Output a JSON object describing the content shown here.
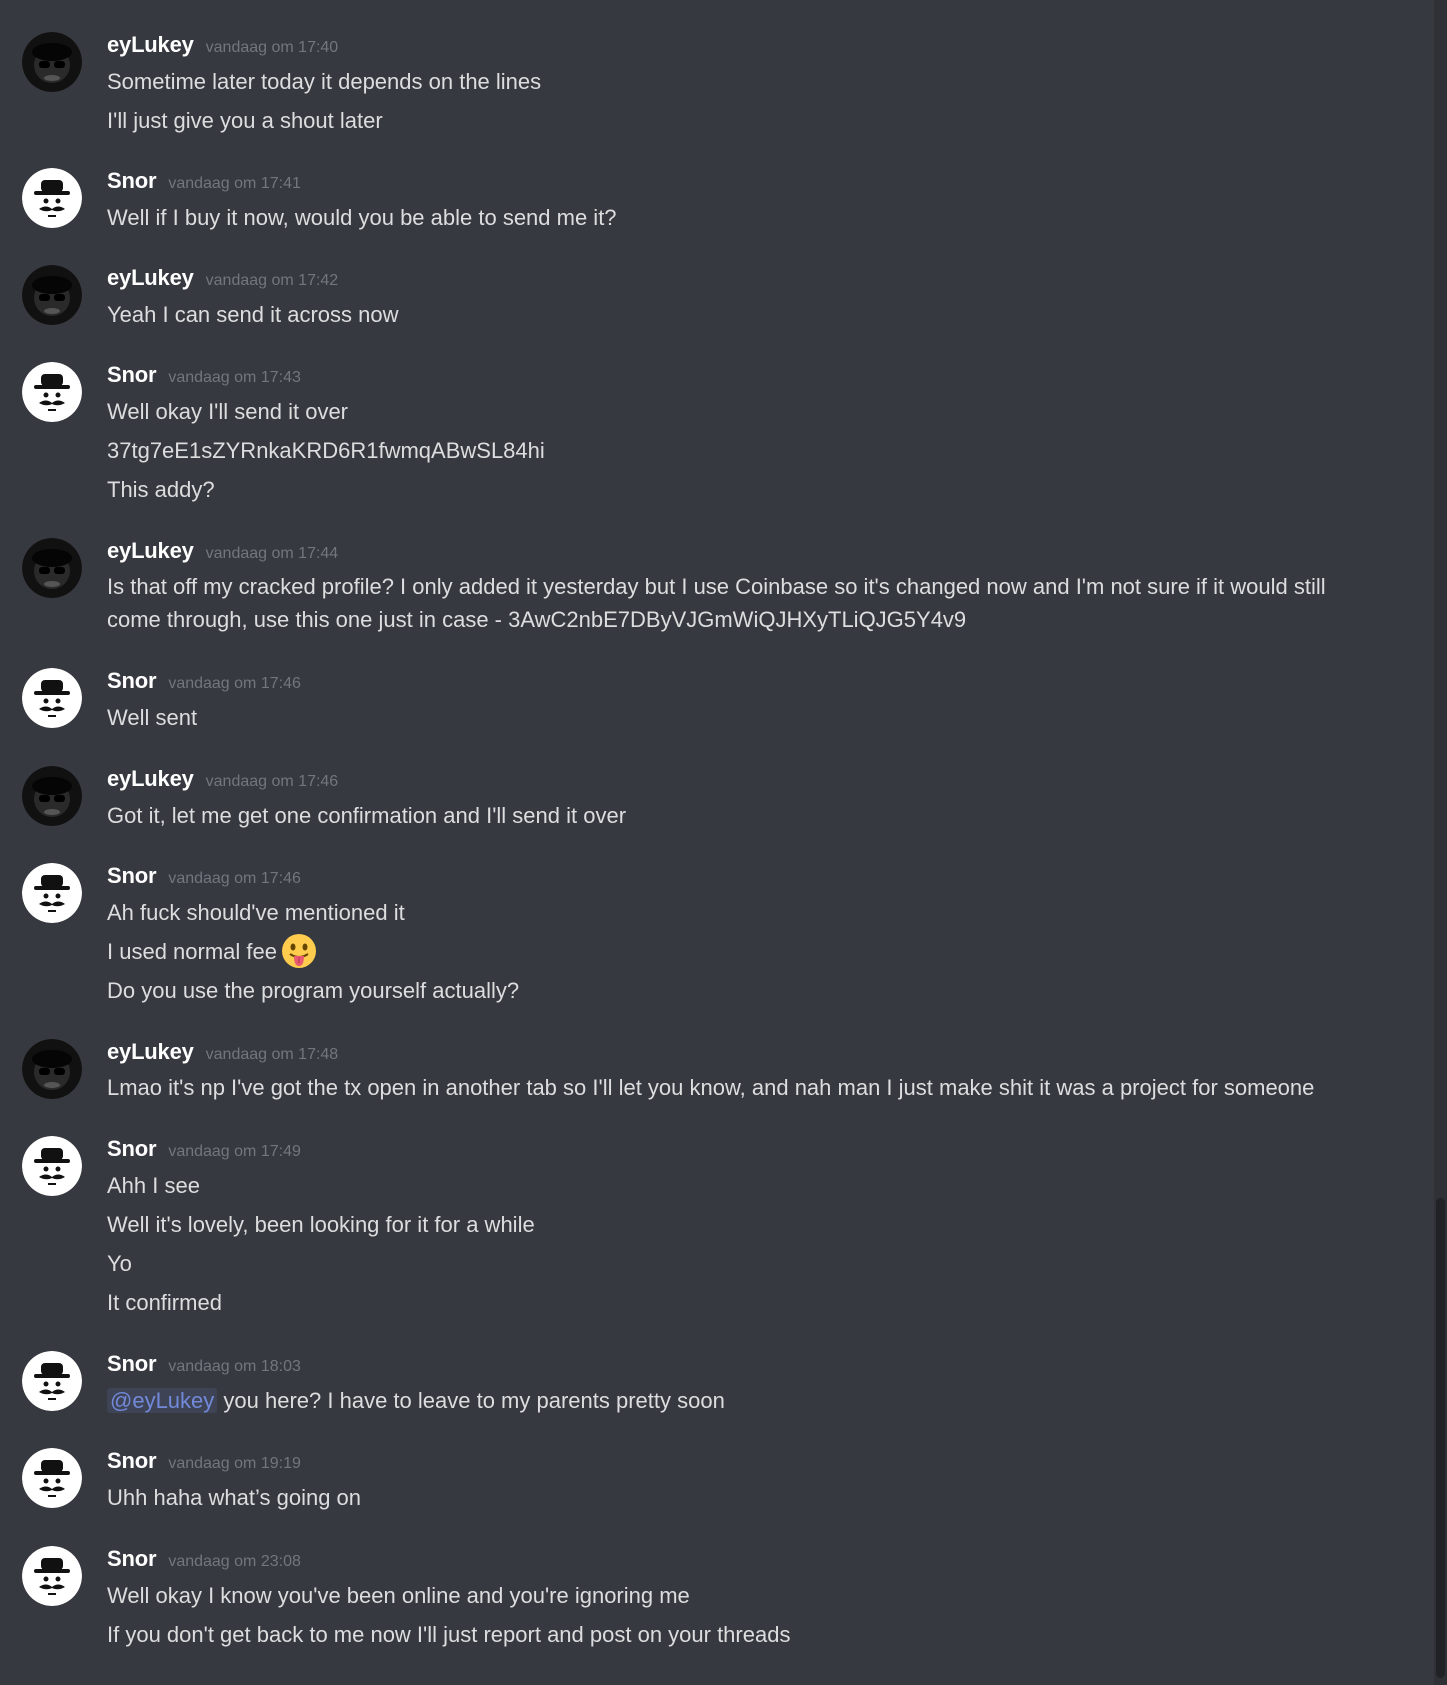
{
  "users": {
    "eylukey": "eyLukey",
    "snor": "Snor"
  },
  "messages": [
    {
      "author": "eyLukey",
      "avatar": "dark-face-avatar",
      "time": "vandaag om 17:40",
      "lines": [
        "Sometime later today it depends on the lines",
        "I'll just give you a shout later"
      ]
    },
    {
      "author": "Snor",
      "avatar": "hat-mustache-avatar",
      "time": "vandaag om 17:41",
      "lines": [
        "Well if I buy it now, would you be able to send me it?"
      ]
    },
    {
      "author": "eyLukey",
      "avatar": "dark-face-avatar",
      "time": "vandaag om 17:42",
      "lines": [
        "Yeah I can send it across now"
      ]
    },
    {
      "author": "Snor",
      "avatar": "hat-mustache-avatar",
      "time": "vandaag om 17:43",
      "lines": [
        "Well okay I'll send it over",
        "37tg7eE1sZYRnkaKRD6R1fwmqABwSL84hi",
        "This addy?"
      ]
    },
    {
      "author": "eyLukey",
      "avatar": "dark-face-avatar",
      "time": "vandaag om 17:44",
      "lines": [
        "Is that off my cracked profile? I only added it yesterday but I use Coinbase so it's changed now and I'm not sure if it would still come through, use this one just in case - 3AwC2nbE7DByVJGmWiQJHXyTLiQJG5Y4v9"
      ]
    },
    {
      "author": "Snor",
      "avatar": "hat-mustache-avatar",
      "time": "vandaag om 17:46",
      "lines": [
        "Well sent"
      ]
    },
    {
      "author": "eyLukey",
      "avatar": "dark-face-avatar",
      "time": "vandaag om 17:46",
      "lines": [
        "Got it, let me get one confirmation and I'll send it over"
      ]
    },
    {
      "author": "Snor",
      "avatar": "hat-mustache-avatar",
      "time": "vandaag om 17:46",
      "lines": [
        "Ah fuck should've mentioned it",
        "I used normal fee",
        "Do you use the program yourself actually?"
      ],
      "emoji": "tongue-out-face-emoji"
    },
    {
      "author": "eyLukey",
      "avatar": "dark-face-avatar",
      "time": "vandaag om 17:48",
      "lines": [
        "Lmao it's np I've got the tx open in another tab so I'll let you know, and nah man I just make shit it was a project for someone"
      ]
    },
    {
      "author": "Snor",
      "avatar": "hat-mustache-avatar",
      "time": "vandaag om 17:49",
      "lines": [
        "Ahh I see",
        "Well it's lovely, been looking for it for a while",
        "Yo",
        "It confirmed"
      ]
    },
    {
      "author": "Snor",
      "avatar": "hat-mustache-avatar",
      "time": "vandaag om 18:03",
      "mention": "@eyLukey",
      "lines": [
        "you here? I have to leave to my parents pretty soon"
      ]
    },
    {
      "author": "Snor",
      "avatar": "hat-mustache-avatar",
      "time": "vandaag om 19:19",
      "lines": [
        "Uhh haha what’s going on"
      ]
    },
    {
      "author": "Snor",
      "avatar": "hat-mustache-avatar",
      "time": "vandaag om 23:08",
      "lines": [
        "Well okay I know you've been online and you're ignoring me",
        "If you don't get back to me now I'll just report and post on your threads"
      ]
    }
  ],
  "colors": {
    "background": "#36393f",
    "author": "#ffffff",
    "timestamp": "#72767d",
    "text": "#dcddde",
    "mention": "#7289da"
  }
}
